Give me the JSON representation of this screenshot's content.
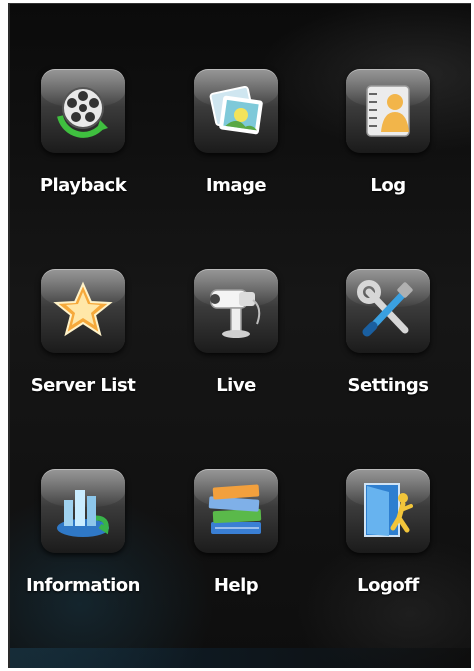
{
  "menu": {
    "items": [
      {
        "label": "Playback",
        "icon": "film-reel-icon"
      },
      {
        "label": "Image",
        "icon": "photo-icon"
      },
      {
        "label": "Log",
        "icon": "log-book-icon"
      },
      {
        "label": "Server List",
        "icon": "star-server-icon"
      },
      {
        "label": "Live",
        "icon": "camera-icon"
      },
      {
        "label": "Settings",
        "icon": "tools-icon"
      },
      {
        "label": "Information",
        "icon": "building-info-icon"
      },
      {
        "label": "Help",
        "icon": "books-icon"
      },
      {
        "label": "Logoff",
        "icon": "exit-door-icon"
      }
    ]
  },
  "colors": {
    "background": "#0b0b0b",
    "label": "#ffffff",
    "tile_top": "#6f6f6f",
    "tile_bottom": "#1b1b1b"
  }
}
